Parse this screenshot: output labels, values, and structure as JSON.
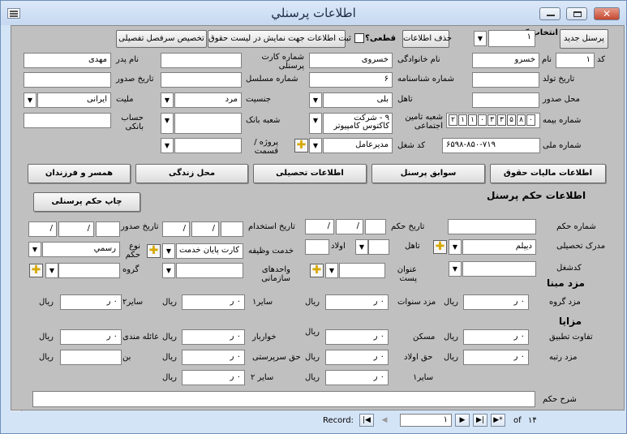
{
  "window": {
    "title": "اطلاعات پرسنلي"
  },
  "toolbar": {
    "new_personnel": "پرسنل جديد",
    "select_code_label": "انتخاب کد",
    "select_code_value": "١",
    "delete_info": "حذف اطلاعات",
    "final_label": "قطعی؟",
    "register_info": "ثبت اطلاعات جهت نمایش در ليست حقوق",
    "assign_detail": "تخصیص سرفصل تفصیلی"
  },
  "personal": {
    "code_label": "کد",
    "code_value": "١",
    "name_label": "نام",
    "name_value": "خسرو",
    "family_label": "نام خانوادگی",
    "family_value": "خسروی",
    "card_label": "شماره کارت پرسنلی",
    "card_value": "",
    "father_label": "نام پدر",
    "father_value": "مهدی",
    "birth_date_label": "تاریخ تولد",
    "id_number_label": "شماره شناسنامه",
    "id_number_value": "۶",
    "serial_label": "شماره مسلسل",
    "issue_date_label": "تاریخ صدور",
    "issue_place_label": "محل صدور",
    "marital_label": "تاهل",
    "marital_value": "بلی",
    "gender_label": "جنسیت",
    "gender_value": "مرد",
    "nationality_label": "ملیت",
    "nationality_value": "ایرانی",
    "insurance_label": "شماره بیمه",
    "insurance_digits": [
      "٢",
      "١",
      "١",
      "٠",
      "٣",
      "٣",
      "۵",
      "٨",
      "٠"
    ],
    "social_branch_label": "شعبه تامین اجتماعی",
    "social_branch_value": "٩ - شرکت کاکتوس کامپیوتر",
    "bank_branch_label": "شعبه بانک",
    "bank_account_label": "حساب بانکی",
    "national_id_label": "شماره ملی",
    "national_id_value": "۶۵٨-٩٨۵٧١٩-٠",
    "job_code_label": "کد شغل",
    "job_code_value": "مدیرعامل",
    "project_label": "پروژه / قسمت"
  },
  "tabs": [
    "اطلاعات ماليات حقوق",
    "سوابق پرسنل",
    "اطلاعات تحصیلی",
    "محل زندگی",
    "همسر و فرزندان"
  ],
  "decree": {
    "section_title": "اطلاعات حکم  پرسنل",
    "print_button": "چاپ حکم پرسنلی",
    "number_label": "شماره حکم",
    "date_label": "تاریخ حکم",
    "employ_date_label": "تاریخ استخدام",
    "issue_date_label": "تاریخ صدور",
    "edu_label": "مدرک تحصيلی",
    "edu_value": "دیپلم",
    "marital_label": "تاهل",
    "children_label": "اولاد",
    "service_label": "خدمت وظیفه",
    "service_value": "کارت پایان خدمت",
    "decree_type_label": "نوع حکم",
    "decree_type_value": "رسمي",
    "job_label": "کدشغل",
    "title_label": "عنوان پست",
    "units_label": "واحدهای سازمانی",
    "group_label": "گروه",
    "date_sep": "/"
  },
  "base_pay": {
    "title": "مزد مبنا",
    "group_wage": "مزد گروه",
    "years_wage": "مزد سنوات",
    "other1": "ساير١",
    "other2": "سایر٢"
  },
  "benefits": {
    "title": "مزايا",
    "apply_diff": "تفاوت تطبيق",
    "housing": "مسکن",
    "groceries": "خواربار",
    "family": "عائله مندی",
    "rank_wage": "مزد رتبه",
    "child_right": "حق اولاد",
    "supervision": "حق سرپرستی",
    "bon": "بن",
    "other1": "ساير١",
    "other2": "ساير ٢"
  },
  "money": {
    "zero": "٠ ر",
    "unit": "ریال"
  },
  "description_label": "شرح حکم",
  "nav": {
    "record_label": "Record:",
    "current": "١",
    "of_label": "of",
    "total": "١۴"
  }
}
